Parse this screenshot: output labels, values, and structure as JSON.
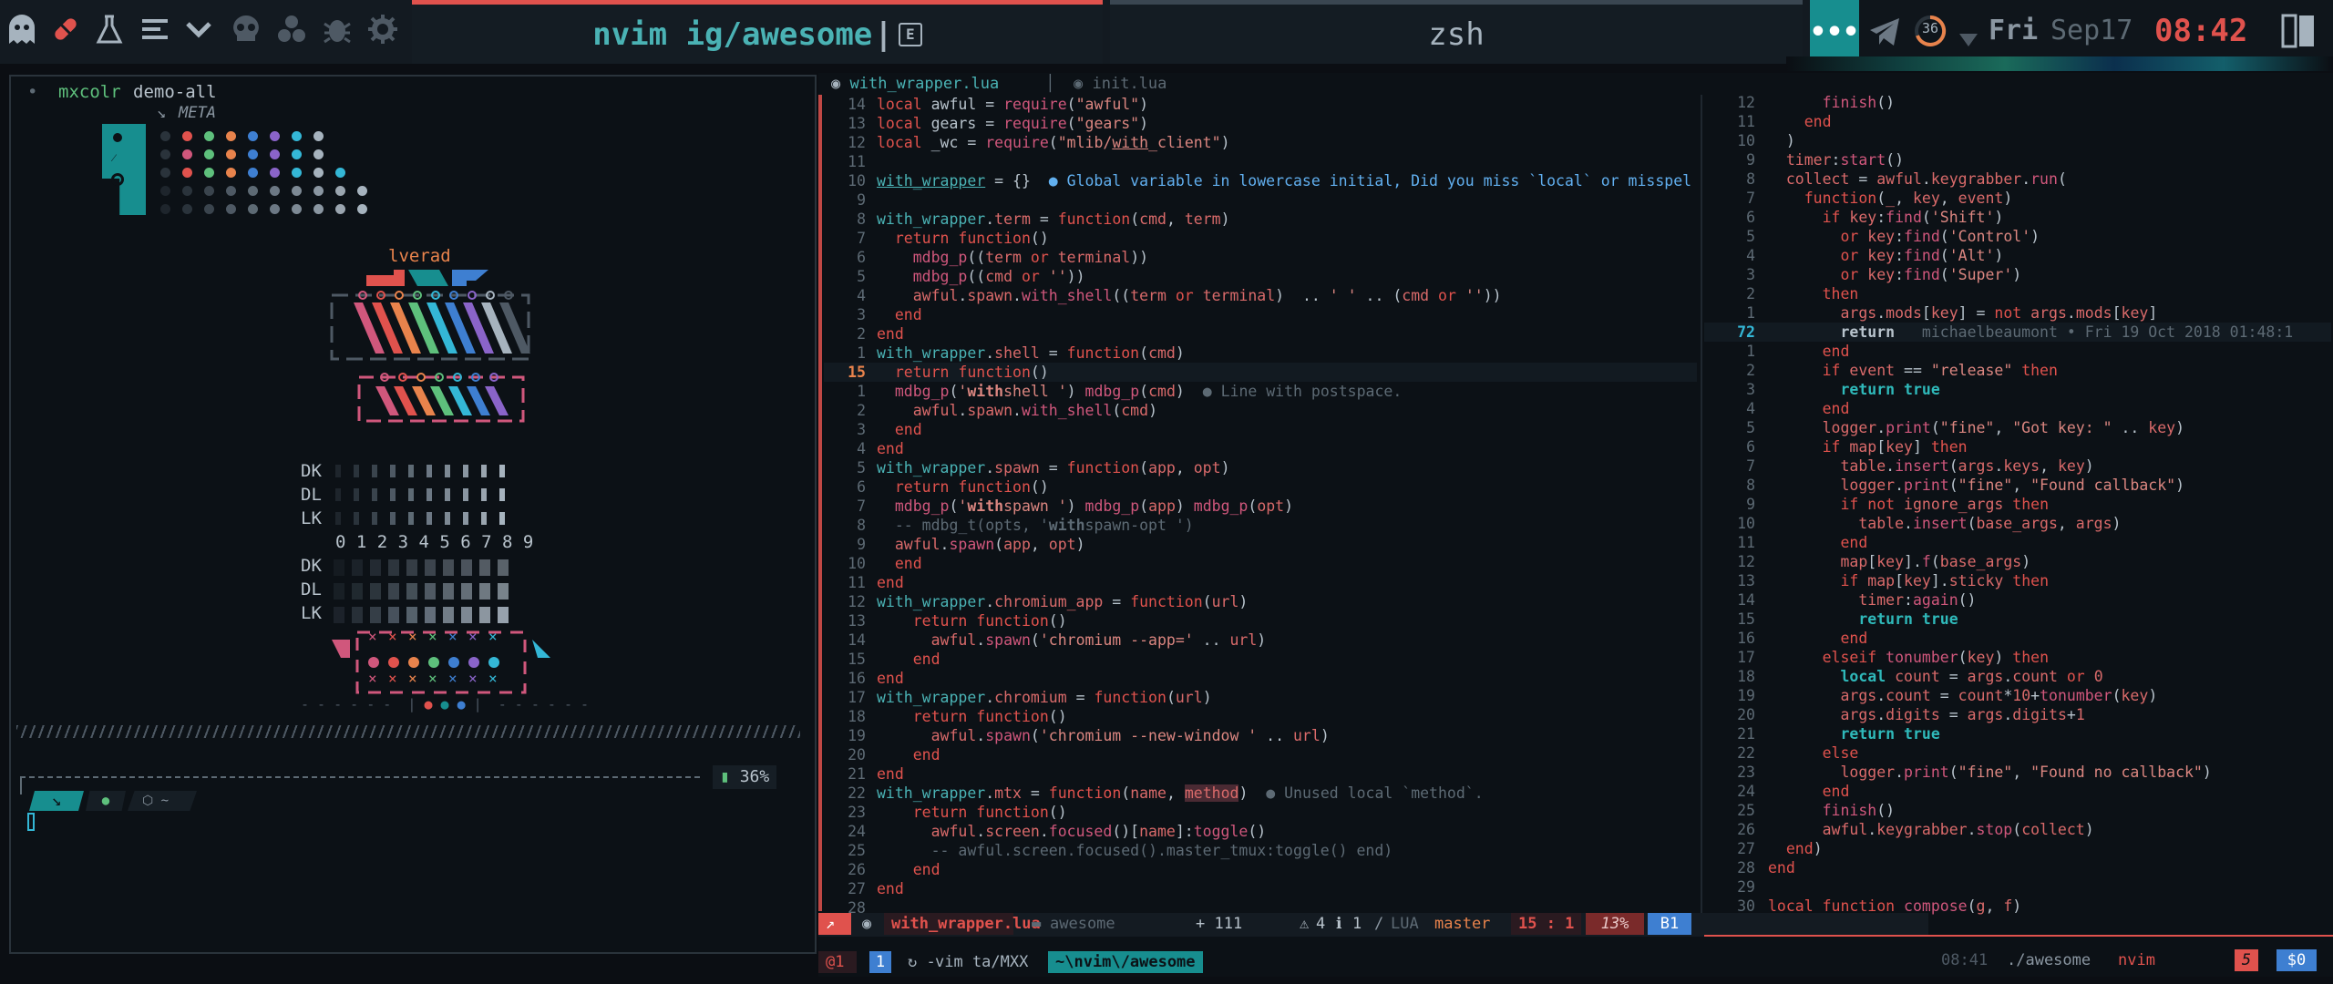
{
  "topbar": {
    "tab_active": "nvim ig/awesome",
    "tab_inactive": "zsh",
    "badge": "36",
    "day": "Fri",
    "date": "Sep17",
    "time": "08:42"
  },
  "left": {
    "prompt_cmd": "mxcolr",
    "prompt_arg": "demo-all",
    "meta": "META",
    "lverad": "lverad",
    "dk": "DK",
    "dl": "DL",
    "lk": "LK",
    "digits": "0 1 2 3 4 5 6 7 8 9",
    "battery": "36%",
    "prompt_path": "~",
    "colors": {
      "red": "#e0524d",
      "teal": "#178e8f",
      "blue": "#3e7fd1",
      "pink": "#d0577c",
      "orange": "#e8834c",
      "green": "#5ec07c",
      "purple": "#8a64c9",
      "cyan": "#34b7d6"
    }
  },
  "editor": {
    "tab1": "with_wrapper.lua",
    "tab2": "init.lua",
    "left_lines": [
      {
        "n": "14",
        "html": "<span class='k'>local</span> <span class='w'>awful</span> = <span class='f'>require</span>(<span class='s'>\"awful\"</span>)"
      },
      {
        "n": "13",
        "html": "<span class='k'>local</span> <span class='w'>gears</span> = <span class='f'>require</span>(<span class='s'>\"gears\"</span>)"
      },
      {
        "n": "12",
        "html": "<span class='k'>local</span> <span class='w'>_wc</span> = <span class='f'>require</span>(<span class='s'>\"mlib/<u>with</u>_client\"</span>)"
      },
      {
        "n": "11",
        "html": ""
      },
      {
        "n": "10",
        "html": "<u class='y'>with_wrapper</u> = {}  <span class='b'>● Global variable in lowercase initial, Did you miss `local` or misspel</span>"
      },
      {
        "n": "9",
        "html": ""
      },
      {
        "n": "8",
        "html": "<span class='y'>with_wrapper</span>.<span class='v'>term</span> = <span class='k'>function</span>(<span class='v'>cmd</span>, <span class='v'>term</span>)"
      },
      {
        "n": "7",
        "html": "  <span class='k'>return</span> <span class='k'>function</span>()"
      },
      {
        "n": "6",
        "html": "    <span class='f'>mdbg_p</span>((<span class='v'>term</span> <span class='k'>or</span> <span class='v'>terminal</span>))"
      },
      {
        "n": "5",
        "html": "    <span class='f'>mdbg_p</span>((<span class='v'>cmd</span> <span class='k'>or</span> <span class='s'>''</span>))"
      },
      {
        "n": "4",
        "html": "    <span class='v'>awful</span>.<span class='v'>spawn</span>.<span class='f'>with_shell</span>((<span class='v'>term</span> <span class='k'>or</span> <span class='v'>terminal</span>)  .. <span class='s'>' '</span> .. (<span class='v'>cmd</span> <span class='k'>or</span> <span class='s'>''</span>))"
      },
      {
        "n": "3",
        "html": "  <span class='k'>end</span>"
      },
      {
        "n": "2",
        "html": "<span class='k'>end</span>"
      },
      {
        "n": "1",
        "html": "<span class='y'>with_wrapper</span>.<span class='v'>shell</span> = <span class='k'>function</span>(<span class='v'>cmd</span>)"
      },
      {
        "n": "15",
        "html": "  <span class='k'>return</span> <span class='k'>function</span>()",
        "cur": true
      },
      {
        "n": "1",
        "html": "  <span class='f'>mdbg_p</span>(<span class='s'>'<b>with</b>shell '</span>) <span class='f'>mdbg_p</span>(<span class='v'>cmd</span>)  <span class='c'>● Line with postspace.</span>"
      },
      {
        "n": "2",
        "html": "    <span class='v'>awful</span>.<span class='v'>spawn</span>.<span class='f'>with_shell</span>(<span class='v'>cmd</span>)"
      },
      {
        "n": "3",
        "html": "  <span class='k'>end</span>"
      },
      {
        "n": "4",
        "html": "<span class='k'>end</span>"
      },
      {
        "n": "5",
        "html": "<span class='y'>with_wrapper</span>.<span class='v'>spawn</span> = <span class='k'>function</span>(<span class='v'>app</span>, <span class='v'>opt</span>)"
      },
      {
        "n": "6",
        "html": "  <span class='k'>return</span> <span class='k'>function</span>()"
      },
      {
        "n": "7",
        "html": "  <span class='f'>mdbg_p</span>(<span class='s'>'<b>with</b>spawn '</span>) <span class='f'>mdbg_p</span>(<span class='v'>app</span>) <span class='f'>mdbg_p</span>(<span class='v'>opt</span>)"
      },
      {
        "n": "8",
        "html": "  <span class='c'>-- mdbg_t(opts, '<b>with</b>spawn-opt ')</span>"
      },
      {
        "n": "9",
        "html": "  <span class='v'>awful</span>.<span class='f'>spawn</span>(<span class='v'>app</span>, <span class='v'>opt</span>)"
      },
      {
        "n": "10",
        "html": "  <span class='k'>end</span>"
      },
      {
        "n": "11",
        "html": "<span class='k'>end</span>"
      },
      {
        "n": "12",
        "html": "<span class='y'>with_wrapper</span>.<span class='v'>chromium_app</span> = <span class='k'>function</span>(<span class='v'>url</span>)"
      },
      {
        "n": "13",
        "html": "    <span class='k'>return</span> <span class='k'>function</span>()"
      },
      {
        "n": "14",
        "html": "      <span class='v'>awful</span>.<span class='f'>spawn</span>(<span class='s'>'chromium --app='</span> .. <span class='v'>url</span>)"
      },
      {
        "n": "15",
        "html": "    <span class='k'>end</span>"
      },
      {
        "n": "16",
        "html": "<span class='k'>end</span>"
      },
      {
        "n": "17",
        "html": "<span class='y'>with_wrapper</span>.<span class='v'>chromium</span> = <span class='k'>function</span>(<span class='v'>url</span>)"
      },
      {
        "n": "18",
        "html": "    <span class='k'>return</span> <span class='k'>function</span>()"
      },
      {
        "n": "19",
        "html": "      <span class='v'>awful</span>.<span class='f'>spawn</span>(<span class='s'>'chromium --new-window '</span> .. <span class='v'>url</span>)"
      },
      {
        "n": "20",
        "html": "    <span class='k'>end</span>"
      },
      {
        "n": "21",
        "html": "<span class='k'>end</span>"
      },
      {
        "n": "22",
        "html": "<span class='y'>with_wrapper</span>.<span class='v'>mtx</span> = <span class='k'>function</span>(<span class='v'>name</span>, <span class='v' style='background:#4a2a33'>method</span>)  <span class='c'>● Unused local `method`.</span>"
      },
      {
        "n": "23",
        "html": "    <span class='k'>return</span> <span class='k'>function</span>()"
      },
      {
        "n": "24",
        "html": "      <span class='v'>awful</span>.<span class='v'>screen</span>.<span class='f'>focused</span>()[<span class='v'>name</span>]:<span class='f'>toggle</span>()"
      },
      {
        "n": "25",
        "html": "      <span class='c'>-- awful.screen.focused().master_tmux:toggle() end)</span>"
      },
      {
        "n": "26",
        "html": "    <span class='k'>end</span>"
      },
      {
        "n": "27",
        "html": "<span class='k'>end</span>"
      },
      {
        "n": "28",
        "html": ""
      }
    ],
    "right_lines": [
      {
        "n": "12",
        "html": "      <span class='f'>finish</span>()"
      },
      {
        "n": "11",
        "html": "    <span class='k'>end</span>"
      },
      {
        "n": "10",
        "html": "  )"
      },
      {
        "n": "9",
        "html": "  <span class='v'>timer</span>:<span class='f'>start</span>()"
      },
      {
        "n": "8",
        "html": "  <span class='v'>collect</span> = <span class='v'>awful</span>.<span class='v'>keygrabber</span>.<span class='f'>run</span>("
      },
      {
        "n": "7",
        "html": "    <span class='k'>function</span>(<span class='v'>_</span>, <span class='v'>key</span>, <span class='v'>event</span>)"
      },
      {
        "n": "6",
        "html": "      <span class='k'>if</span> <span class='v'>key</span>:<span class='f'>find</span>(<span class='s'>'Shift'</span>)"
      },
      {
        "n": "5",
        "html": "        <span class='k'>or</span> <span class='v'>key</span>:<span class='f'>find</span>(<span class='s'>'Control'</span>)"
      },
      {
        "n": "4",
        "html": "        <span class='k'>or</span> <span class='v'>key</span>:<span class='f'>find</span>(<span class='s'>'Alt'</span>)"
      },
      {
        "n": "3",
        "html": "        <span class='k'>or</span> <span class='v'>key</span>:<span class='f'>find</span>(<span class='s'>'Super'</span>)"
      },
      {
        "n": "2",
        "html": "      <span class='k'>then</span>"
      },
      {
        "n": "1",
        "html": "        <span class='v'>args</span>.<span class='v'>mods</span>[<span class='v'>key</span>] = <span class='k'>not</span> <span class='v'>args</span>.<span class='v'>mods</span>[<span class='v'>key</span>]"
      },
      {
        "n": "72",
        "html": "        <b class='w'>return</b>   <span class='c'>michaelbeaumont • Fri 19 Oct 2018 01:48:1</span>",
        "cur": true
      },
      {
        "n": "1",
        "html": "      <span class='k'>end</span>"
      },
      {
        "n": "2",
        "html": "      <span class='k'>if</span> <span class='v'>event</span> == <span class='s'>\"release\"</span> <span class='k'>then</span>"
      },
      {
        "n": "3",
        "html": "        <b class='t'>return</b> <b class='t'>true</b>"
      },
      {
        "n": "4",
        "html": "      <span class='k'>end</span>"
      },
      {
        "n": "5",
        "html": "      <span class='v'>logger</span>.<span class='f'>print</span>(<span class='s'>\"fine\"</span>, <span class='s'>\"Got key: \"</span> .. <span class='v'>key</span>)"
      },
      {
        "n": "6",
        "html": "      <span class='k'>if</span> <span class='v'>map</span>[<span class='v'>key</span>] <span class='k'>then</span>"
      },
      {
        "n": "7",
        "html": "        <span class='v'>table</span>.<span class='f'>insert</span>(<span class='v'>args</span>.<span class='v'>keys</span>, <span class='v'>key</span>)"
      },
      {
        "n": "8",
        "html": "        <span class='v'>logger</span>.<span class='f'>print</span>(<span class='s'>\"fine\"</span>, <span class='s'>\"Found callback\"</span>)"
      },
      {
        "n": "9",
        "html": "        <span class='k'>if</span> <span class='k'>not</span> <span class='v'>ignore_args</span> <span class='k'>then</span>"
      },
      {
        "n": "10",
        "html": "          <span class='v'>table</span>.<span class='f'>insert</span>(<span class='v'>base_args</span>, <span class='v'>args</span>)"
      },
      {
        "n": "11",
        "html": "        <span class='k'>end</span>"
      },
      {
        "n": "12",
        "html": "        <span class='v'>map</span>[<span class='v'>key</span>].<span class='f'>f</span>(<span class='v'>base_args</span>)"
      },
      {
        "n": "13",
        "html": "        <span class='k'>if</span> <span class='v'>map</span>[<span class='v'>key</span>].<span class='v'>sticky</span> <span class='k'>then</span>"
      },
      {
        "n": "14",
        "html": "          <span class='v'>timer</span>:<span class='f'>again</span>()"
      },
      {
        "n": "15",
        "html": "          <b class='t'>return</b> <b class='t'>true</b>"
      },
      {
        "n": "16",
        "html": "        <span class='k'>end</span>"
      },
      {
        "n": "17",
        "html": "      <span class='k'>elseif</span> <span class='f'>tonumber</span>(<span class='v'>key</span>) <span class='k'>then</span>"
      },
      {
        "n": "18",
        "html": "        <b class='t'>local</b> <span class='v'>count</span> = <span class='v'>args</span>.<span class='v'>count</span> <span class='k'>or</span> <span class='v'>0</span>"
      },
      {
        "n": "19",
        "html": "        <span class='v'>args</span>.<span class='v'>count</span> = <span class='v'>count</span>*<span class='v'>10</span>+<span class='f'>tonumber</span>(<span class='v'>key</span>)"
      },
      {
        "n": "20",
        "html": "        <span class='v'>args</span>.<span class='v'>digits</span> = <span class='v'>args</span>.<span class='v'>digits</span>+<span class='v'>1</span>"
      },
      {
        "n": "21",
        "html": "        <b class='t'>return</b> <b class='t'>true</b>"
      },
      {
        "n": "22",
        "html": "      <span class='k'>else</span>"
      },
      {
        "n": "23",
        "html": "        <span class='v'>logger</span>.<span class='f'>print</span>(<span class='s'>\"fine\"</span>, <span class='s'>\"Found no callback\"</span>)"
      },
      {
        "n": "24",
        "html": "      <span class='k'>end</span>"
      },
      {
        "n": "25",
        "html": "      <span class='f'>finish</span>()"
      },
      {
        "n": "26",
        "html": "      <span class='v'>awful</span>.<span class='v'>keygrabber</span>.<span class='f'>stop</span>(<span class='v'>collect</span>)"
      },
      {
        "n": "27",
        "html": "  <span class='k'>end</span>)"
      },
      {
        "n": "28",
        "html": "<span class='k'>end</span>"
      },
      {
        "n": "29",
        "html": ""
      },
      {
        "n": "30",
        "html": "<span class='k'>local</span> <span class='k'>function</span> <span class='f'>compose</span>(<span class='v'>g</span>, <span class='v'>f</span>)"
      }
    ],
    "status": {
      "filename": "with_wrapper.lua",
      "dir": "awesome",
      "added": "+ 111",
      "warn": "4",
      "info": "1",
      "lang": "LUA",
      "branch": "master",
      "pos": "15 : 1",
      "pct": "13%",
      "buf": "B1"
    },
    "status_right": {
      "time": "08:41",
      "path": "./awesome",
      "app": "nvim",
      "n": "5",
      "cost": "$0"
    },
    "bottom": {
      "s1": "@1",
      "s2": "1",
      "s3": "vim ta/MXX",
      "s4": "~\\nvim\\/awesome"
    }
  }
}
